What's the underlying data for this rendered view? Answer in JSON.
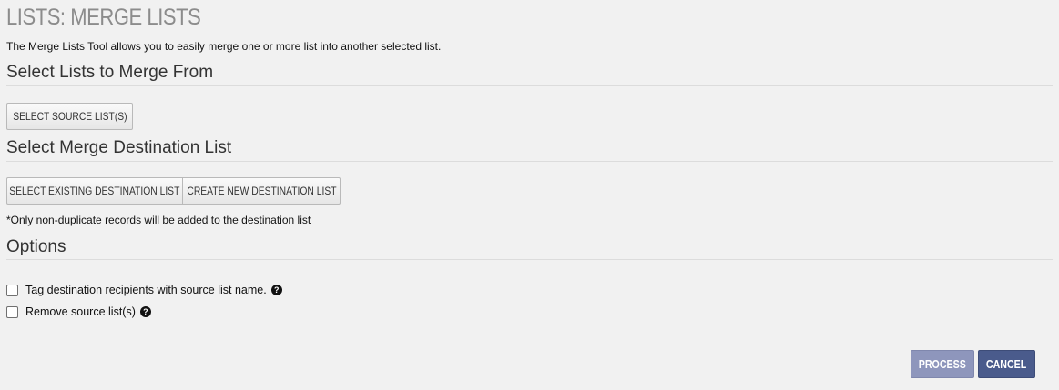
{
  "page": {
    "title": "LISTS: MERGE LISTS",
    "intro": "The Merge Lists Tool allows you to easily merge one or more list into another selected list."
  },
  "sections": {
    "source": {
      "heading": "Select Lists to Merge From",
      "button_label": "SELECT SOURCE LIST(S)"
    },
    "destination": {
      "heading": "Select Merge Destination List",
      "existing_button_label": "SELECT EXISTING DESTINATION LIST",
      "new_button_label": "CREATE NEW DESTINATION LIST",
      "note": "*Only non-duplicate records will be added to the destination list"
    },
    "options": {
      "heading": "Options",
      "items": [
        {
          "label": "Tag destination recipients with source list name.",
          "checked": false,
          "icon": "question-circle-icon"
        },
        {
          "label": "Remove source list(s)",
          "checked": false,
          "icon": "question-circle-icon"
        }
      ]
    }
  },
  "actions": {
    "process_label": "PROCESS",
    "cancel_label": "CANCEL"
  },
  "colors": {
    "title": "#8c8c8c",
    "process_bg": "#8e96bc",
    "cancel_bg": "#4a5b8c"
  }
}
